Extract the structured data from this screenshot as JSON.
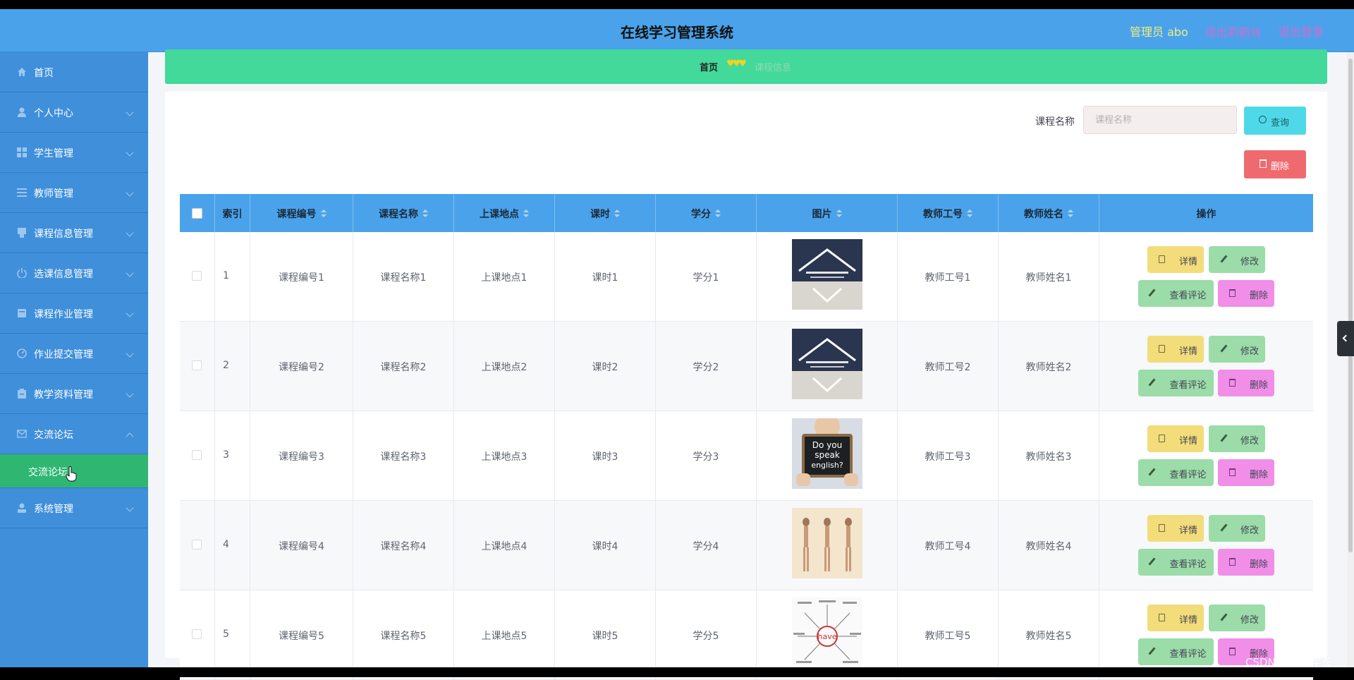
{
  "header": {
    "title": "在线学习管理系统",
    "user_label": "管理员 abo",
    "front_link": "退出到前台",
    "logout_link": "退出登录"
  },
  "sidebar": {
    "items": [
      {
        "label": "首页",
        "icon": "home-icon"
      },
      {
        "label": "个人中心",
        "icon": "user-icon"
      },
      {
        "label": "学生管理",
        "icon": "grid-icon"
      },
      {
        "label": "教师管理",
        "icon": "list-icon"
      },
      {
        "label": "课程信息管理",
        "icon": "book-icon"
      },
      {
        "label": "选课信息管理",
        "icon": "power-icon"
      },
      {
        "label": "课程作业管理",
        "icon": "folder-icon"
      },
      {
        "label": "作业提交管理",
        "icon": "gauge-icon"
      },
      {
        "label": "教学资料管理",
        "icon": "clipboard-icon"
      },
      {
        "label": "交流论坛",
        "icon": "mail-icon"
      },
      {
        "label": "系统管理",
        "icon": "admin-icon"
      }
    ],
    "active_sub": "交流论坛"
  },
  "breadcrumb": {
    "home": "首页",
    "separator": "♥♥♥",
    "current": "课程信息"
  },
  "search": {
    "label": "课程名称",
    "placeholder": "课程名称",
    "query_button": "查询",
    "delete_button": "删除"
  },
  "table": {
    "headers": {
      "index": "索引",
      "course_no": "课程编号",
      "course_name": "课程名称",
      "location": "上课地点",
      "hours": "课时",
      "credits": "学分",
      "image": "图片",
      "teacher_no": "教师工号",
      "teacher_name": "教师姓名",
      "actions": "操作"
    },
    "rows": [
      {
        "index": "1",
        "course_no": "课程编号1",
        "course_name": "课程名称1",
        "location": "上课地点1",
        "hours": "课时1",
        "credits": "学分1",
        "teacher_no": "教师工号1",
        "teacher_name": "教师姓名1"
      },
      {
        "index": "2",
        "course_no": "课程编号2",
        "course_name": "课程名称2",
        "location": "上课地点2",
        "hours": "课时2",
        "credits": "学分2",
        "teacher_no": "教师工号2",
        "teacher_name": "教师姓名2"
      },
      {
        "index": "3",
        "course_no": "课程编号3",
        "course_name": "课程名称3",
        "location": "上课地点3",
        "hours": "课时3",
        "credits": "学分3",
        "teacher_no": "教师工号3",
        "teacher_name": "教师姓名3"
      },
      {
        "index": "4",
        "course_no": "课程编号4",
        "course_name": "课程名称4",
        "location": "上课地点4",
        "hours": "课时4",
        "credits": "学分4",
        "teacher_no": "教师工号4",
        "teacher_name": "教师姓名4"
      },
      {
        "index": "5",
        "course_no": "课程编号5",
        "course_name": "课程名称5",
        "location": "上课地点5",
        "hours": "课时5",
        "credits": "学分5",
        "teacher_no": "教师工号5",
        "teacher_name": "教师姓名5"
      }
    ],
    "action_labels": {
      "detail": "详情",
      "edit": "修改",
      "comment": "查看评论",
      "delete": "删除"
    },
    "image_texts": {
      "row3": [
        "Do you",
        "speak",
        "english?"
      ],
      "row5": "have"
    }
  },
  "watermark": "CSDN @卓杰学长",
  "colors": {
    "header": "#4aa3ea",
    "sidebar": "#3f8fdb",
    "active_menu": "#2fb772",
    "breadcrumb": "#42d99b",
    "query_button": "#4fd9e8",
    "delete_button": "#ef6a6f",
    "detail_button": "#f3dc7a",
    "edit_button": "#9bdca8",
    "row_delete_button": "#f08ee8"
  }
}
